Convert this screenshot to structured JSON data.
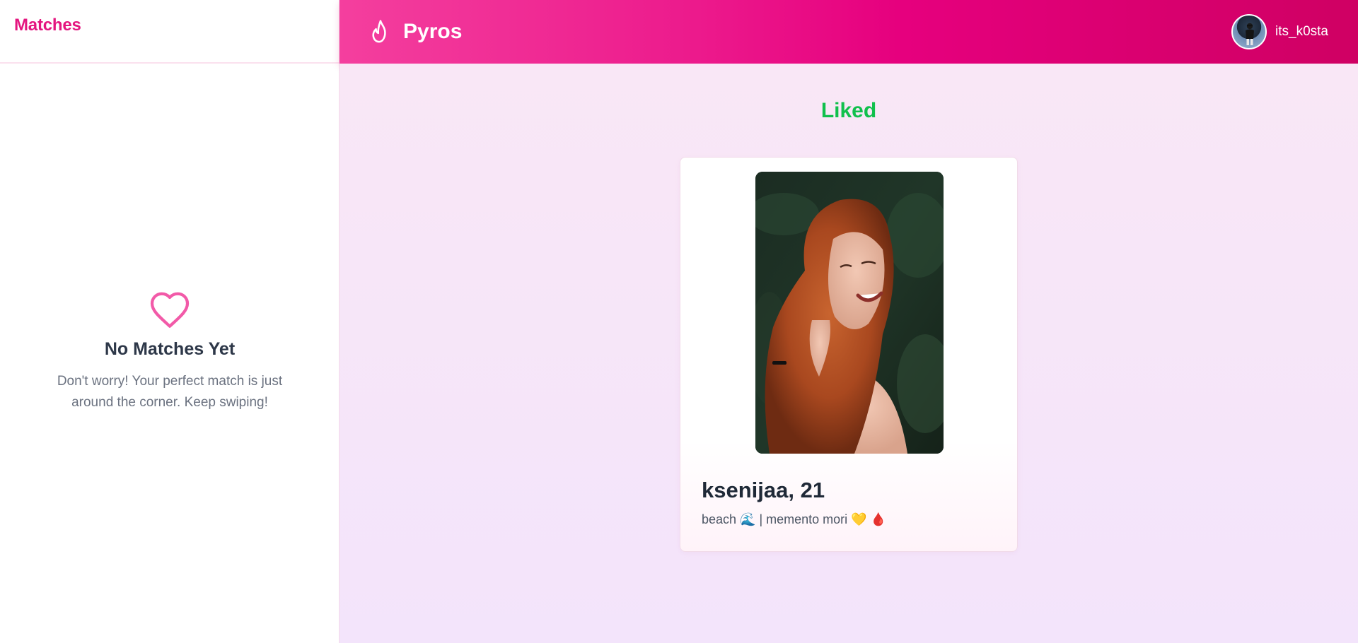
{
  "sidebar": {
    "title": "Matches",
    "empty_state": {
      "icon": "heart-outline-icon",
      "title": "No Matches Yet",
      "description": "Don't worry! Your perfect match is just around the corner. Keep swiping!"
    }
  },
  "header": {
    "logo_icon": "flame-icon",
    "brand_name": "Pyros",
    "user": {
      "username": "its_k0sta",
      "avatar_icon": "user-avatar"
    }
  },
  "main": {
    "status_label": "Liked",
    "profile_card": {
      "name_age": "ksenijaa, 21",
      "bio": "beach 🌊 | memento mori 💛 🩸"
    }
  },
  "colors": {
    "brand_pink": "#e4157f",
    "liked_green": "#10c04c",
    "header_gradient_start": "#f43f9e",
    "header_gradient_end": "#cf0063",
    "main_background": "#f6e6f8"
  }
}
